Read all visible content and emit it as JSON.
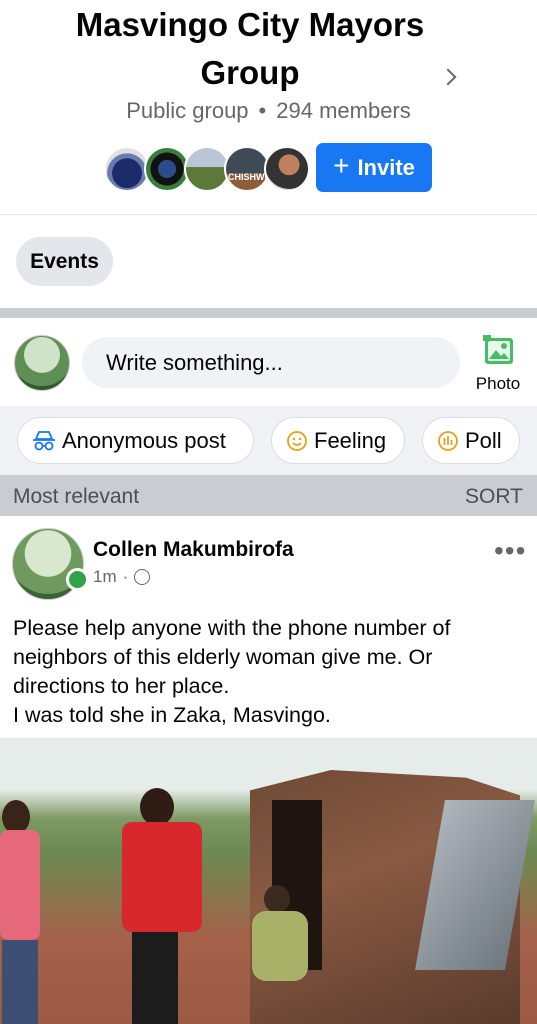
{
  "group": {
    "name_line1": "Masvingo City Mayors",
    "name_line2": "Group",
    "privacy": "Public group",
    "members": "294 members",
    "member_avatar_label": "CHISHWE"
  },
  "invite": {
    "plus": "+",
    "label": "Invite"
  },
  "tabs": {
    "events": "Events"
  },
  "composer": {
    "placeholder": "Write something...",
    "photo_label": "Photo"
  },
  "actions": {
    "anonymous": "Anonymous post",
    "feeling": "Feeling",
    "poll": "Poll"
  },
  "feed": {
    "filter": "Most relevant",
    "sort": "SORT"
  },
  "post": {
    "author": "Collen Makumbirofa",
    "time": "1m",
    "separator": "·",
    "text_lines": [
      "Please help anyone with the phone number of",
      "neighbors of this elderly woman give me. Or",
      "directions to her place.",
      "I was told she in Zaka, Masvingo."
    ]
  },
  "colors": {
    "accent": "#1877f2",
    "online": "#31a24c",
    "secondary_text": "#65676b"
  },
  "icons": {
    "chevron": "chevron-right-icon",
    "photo": "photo-icon",
    "anonymous": "anonymous-icon",
    "feeling": "smiley-icon",
    "poll": "poll-icon",
    "privacy": "globe-icon",
    "more": "more-icon"
  }
}
